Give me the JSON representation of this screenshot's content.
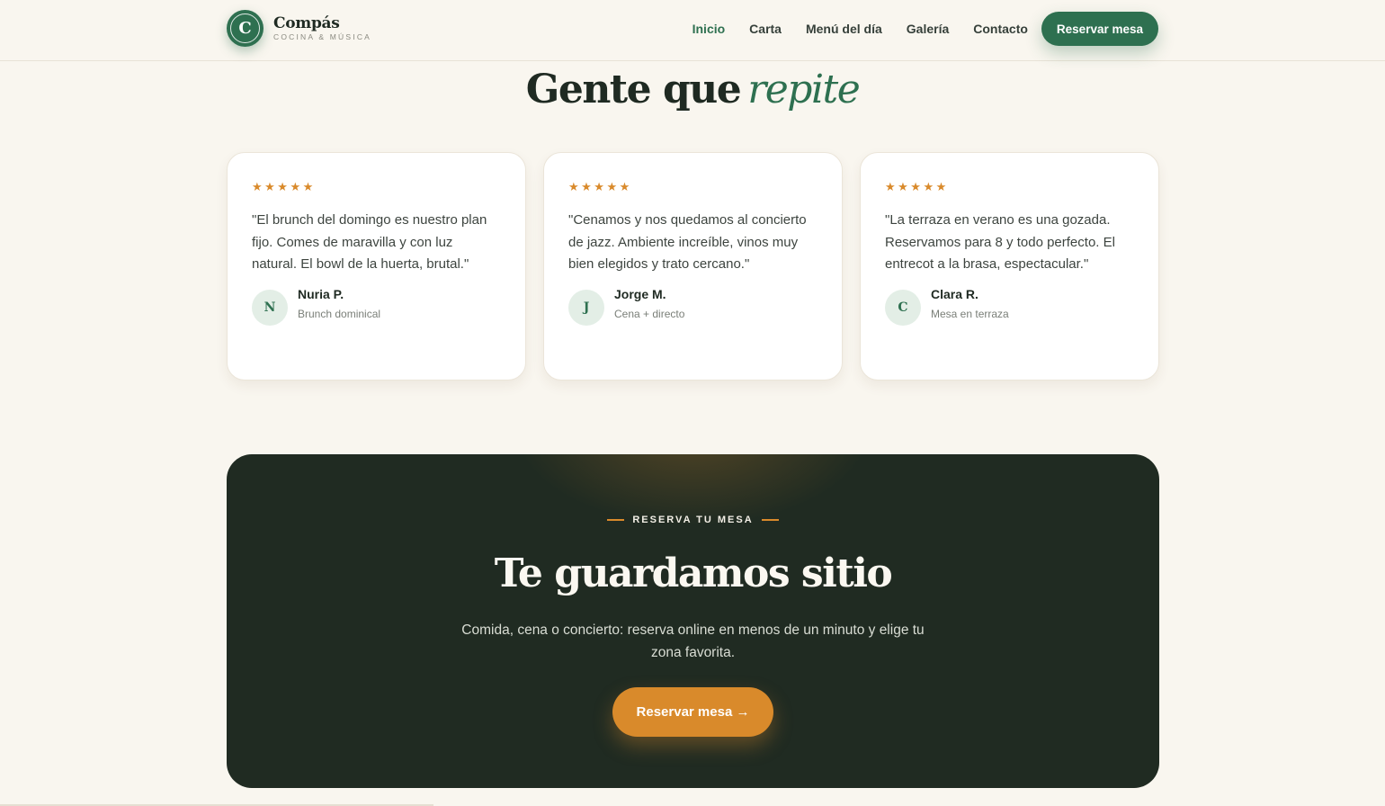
{
  "header": {
    "logo_letter": "C",
    "logo_name": "Compás",
    "logo_tagline": "COCINA & MÚSICA",
    "nav": [
      "Inicio",
      "Carta",
      "Menú del día",
      "Galería",
      "Contacto"
    ],
    "active_nav": "Inicio",
    "reserve_label": "Reservar mesa"
  },
  "testimonials": {
    "title": "Gente que",
    "title_emphasis": "repite",
    "stars": "★★★★★",
    "items": [
      {
        "rating": 5,
        "quote": "\"El brunch del domingo es nuestro plan fijo. Comes de maravilla y con luz natural. El bowl de la huerta, brutal.\"",
        "initial": "N",
        "name": "Nuria P.",
        "meta": "Brunch dominical"
      },
      {
        "rating": 5,
        "quote": "\"Cenamos y nos quedamos al concierto de jazz. Ambiente increíble, vinos muy bien elegidos y trato cercano.\"",
        "initial": "J",
        "name": "Jorge M.",
        "meta": "Cena + directo"
      },
      {
        "rating": 5,
        "quote": "\"La terraza en verano es una gozada. Reservamos para 8 y todo perfecto. El entrecot a la brasa, espectacular.\"",
        "initial": "C",
        "name": "Clara R.",
        "meta": "Mesa en terraza"
      }
    ]
  },
  "cta": {
    "eyebrow": "RESERVA TU MESA",
    "title": "Te guardamos sitio",
    "text": "Comida, cena o concierto: reserva online en menos de un minuto y elige tu zona favorita.",
    "button": "Reservar mesa →"
  },
  "colors": {
    "brand_green": "#2e7050",
    "accent_orange": "#d98a2b",
    "dark_bg": "#202b22",
    "page_bg": "#f9f6ef"
  }
}
